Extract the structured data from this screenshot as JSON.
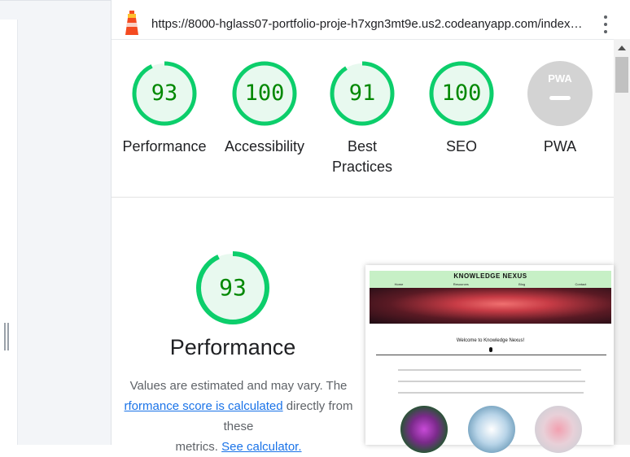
{
  "url": "https://8000-hglass07-portfolio-proje-h7xgn3mt9e.us2.codeanyapp.com/index…",
  "scores": [
    {
      "label": "Performance",
      "value": "93",
      "score": 93
    },
    {
      "label": "Accessibility",
      "value": "100",
      "score": 100
    },
    {
      "label": "Best Practices",
      "value": "91",
      "score": 91
    },
    {
      "label": "SEO",
      "value": "100",
      "score": 100
    },
    {
      "label": "PWA",
      "value": "PWA",
      "score": null
    }
  ],
  "detail": {
    "score_value": "93",
    "score": 93,
    "title": "Performance",
    "note_part1": "Values are estimated and may vary. The",
    "link1": "rformance score is calculated",
    "note_part2": "directly from these",
    "note_part3": "metrics.",
    "link2": "See calculator."
  },
  "preview": {
    "brand": "KNOWLEDGE NEXUS",
    "nav": [
      "Home",
      "Resources",
      "Blog",
      "Contact"
    ],
    "welcome": "Welcome to Knowledge Nexus!"
  },
  "colors": {
    "pass": "#0cce6b",
    "pass_bg": "#e8f9ef",
    "pass_text": "#008800",
    "pwa_gray": "#d3d3d3"
  }
}
